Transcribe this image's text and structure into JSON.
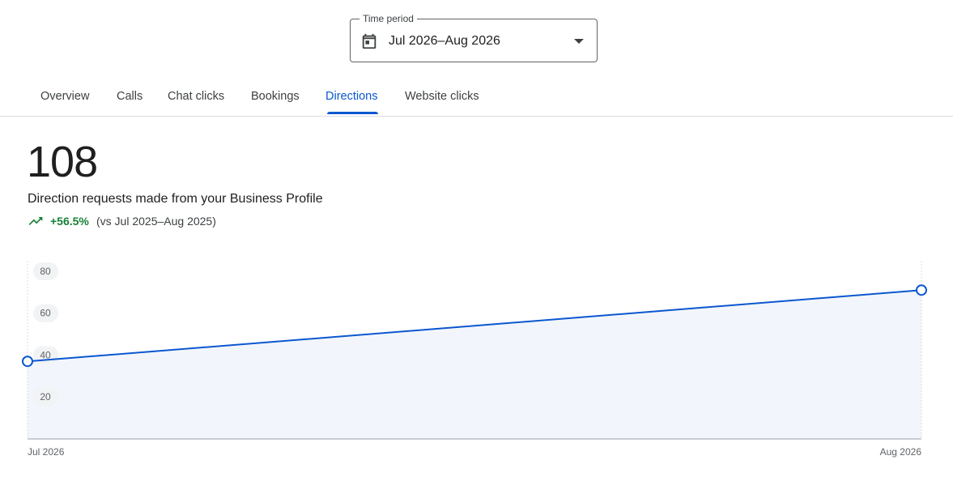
{
  "time_period": {
    "label": "Time period",
    "value": "Jul 2026–Aug 2026"
  },
  "tabs": [
    {
      "label": "Overview"
    },
    {
      "label": "Calls"
    },
    {
      "label": "Chat clicks"
    },
    {
      "label": "Bookings"
    },
    {
      "label": "Directions",
      "active": true
    },
    {
      "label": "Website clicks"
    }
  ],
  "metric": {
    "value": "108",
    "description": "Direction requests made from your Business Profile",
    "change": "+56.5%",
    "comparison": "(vs Jul 2025–Aug 2025)"
  },
  "colors": {
    "accent": "#0b57d0",
    "positive": "#188038",
    "area_fill": "#f2f6fc"
  },
  "chart_data": {
    "type": "area",
    "x": [
      "Jul 2026",
      "Aug 2026"
    ],
    "series": [
      {
        "values": [
          37,
          71
        ]
      }
    ],
    "yticks": [
      20,
      40,
      60,
      80
    ],
    "ylim": [
      0,
      85
    ],
    "grid": false
  }
}
